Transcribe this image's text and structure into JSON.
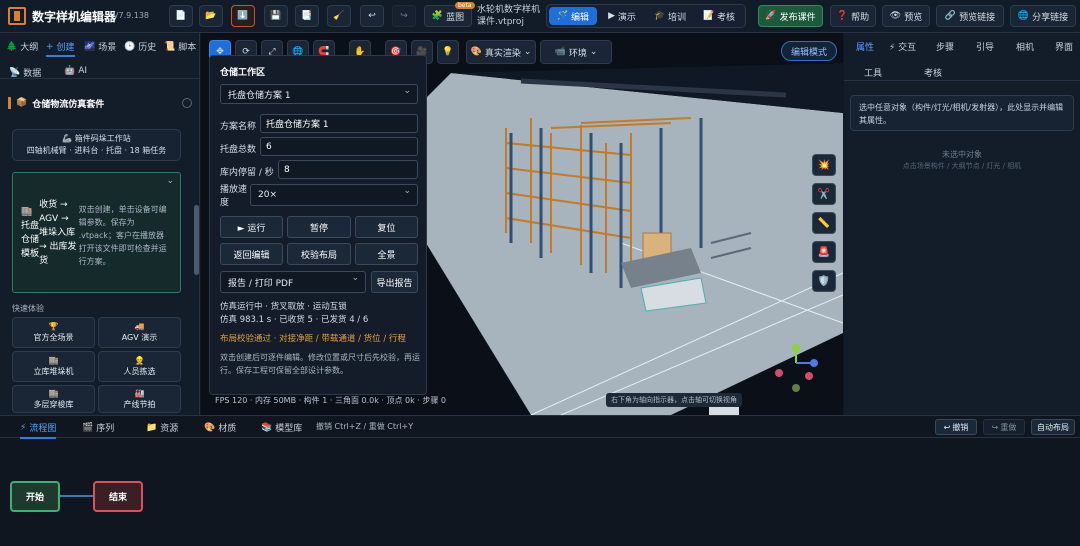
{
  "app": {
    "title": "数字样机编辑器",
    "version": "V7.9.138",
    "badge": "beta",
    "project": "水轮机数字样机课件.vtproj"
  },
  "toolbar": {
    "new_icon": "📄",
    "open_icon": "📂",
    "import_icon": "⬇️",
    "save_icon": "💾",
    "saveas_icon": "📑",
    "clear_icon": "🧹",
    "undo_icon": "↩",
    "redo_icon": "↪",
    "blueprint_icon": "🧩",
    "blueprint_label": "蓝图",
    "modes": [
      {
        "icon": "🪄",
        "label": "编辑"
      },
      {
        "icon": "▶",
        "label": "演示"
      },
      {
        "icon": "🎓",
        "label": "培训"
      },
      {
        "icon": "📝",
        "label": "考核"
      }
    ],
    "publish_icon": "🚀",
    "publish_label": "发布课件",
    "help_icon": "❓",
    "help_label": "帮助",
    "preview_icon": "👁",
    "preview_label": "预览",
    "preview_link_icon": "🔗",
    "preview_link_label": "预览链接",
    "share_icon": "🌐",
    "share_label": "分享链接"
  },
  "left": {
    "tabs": [
      {
        "icon": "🌲",
        "label": "大纲"
      },
      {
        "icon": "+",
        "label": "创建"
      },
      {
        "icon": "🌌",
        "label": "场景"
      },
      {
        "icon": "🕒",
        "label": "历史"
      },
      {
        "icon": "📜",
        "label": "脚本"
      },
      {
        "icon": "📡",
        "label": "数据"
      },
      {
        "icon": "🤖",
        "label": "AI"
      }
    ],
    "kit_icon": "📦",
    "kit_title": "仓储物流仿真套件",
    "card1_icon": "🦾",
    "card1_title": "箱件码垛工作站",
    "card1_desc": "四轴机械臂 · 进料台 · 托盘 · 18 箱任务",
    "card2_icon": "🏬",
    "card2_title": "托盘仓储模板",
    "card2_flow": "收货 → AGV → 堆垛入库 → 出库发货",
    "card2_desc": "双击创建，单击设备可编辑参数。保存为 .vtpack；客户在播放器打开该文件即可检查并运行方案。",
    "quick_title": "快速体验",
    "quick": [
      {
        "icon": "🏆",
        "label": "官方全场景"
      },
      {
        "icon": "🚚",
        "label": "AGV 演示"
      },
      {
        "icon": "🏬",
        "label": "立库堆垛机"
      },
      {
        "icon": "👷",
        "label": "人员拣选"
      },
      {
        "icon": "🏬",
        "label": "多层穿梭库"
      },
      {
        "icon": "🏭",
        "label": "产线节拍"
      }
    ]
  },
  "viewport": {
    "render_icon": "🎨",
    "render_label": "真实渲染",
    "env_icon": "📹",
    "env_label": "环境",
    "edit_mode": "编辑模式",
    "fps": "FPS 120 · 内存 50MB · 构件 1 · 三角面 0.0k · 顶点 0k · 步骤 0",
    "hint": "右下角为轴向指示器，点击轴可切换视角",
    "tool_icons": [
      "💥",
      "✂️",
      "📏",
      "🚨",
      "🛡️"
    ]
  },
  "panel": {
    "title": "仓储工作区",
    "scheme_select": "托盘仓储方案 1",
    "name_label": "方案名称",
    "name_value": "托盘仓储方案 1",
    "pallet_label": "托盘总数",
    "pallet_value": "6",
    "dwell_label": "库内停留 / 秒",
    "dwell_value": "8",
    "speed_label": "播放速度",
    "speed_value": "20×",
    "btn_run": "► 运行",
    "btn_pause": "暂停",
    "btn_reset": "复位",
    "btn_back": "返回编辑",
    "btn_check": "校验布局",
    "btn_full": "全景",
    "report_select": "报告 / 打印 PDF",
    "btn_export": "导出报告",
    "status1": "仿真运行中 · 货叉取放 · 运动互锁",
    "status2": "仿真 983.1 s · 已收货 5 · 已发货 4 / 6",
    "check": "布局校验通过 · 对接净距 / 带载通道 / 货位 / 行程",
    "note": "双击创建后可逐件编辑。修改位置或尺寸后先校验，再运行。保存工程可保留全部设计参数。"
  },
  "right": {
    "tabs": [
      "属性",
      "⚡ 交互",
      "步骤",
      "引导",
      "相机",
      "界面"
    ],
    "subtabs": [
      "工具",
      "考核"
    ],
    "info": "选中任意对象（构件/灯光/相机/发射器），此处显示并编辑其属性。",
    "empty_title": "未选中对象",
    "empty_hint": "点击场景构件 / 大纲节点 / 灯光 / 相机"
  },
  "bottom": {
    "tabs": [
      {
        "icon": "⚡",
        "label": "流程图"
      },
      {
        "icon": "🎬",
        "label": "序列"
      },
      {
        "icon": "📁",
        "label": "资源"
      },
      {
        "icon": "🎨",
        "label": "材质"
      },
      {
        "icon": "📚",
        "label": "模型库"
      }
    ],
    "shortcut": "撤销 Ctrl+Z / 重做 Ctrl+Y",
    "undo": "撤销",
    "redo": "重做",
    "autolayout": "自动布局",
    "node_start": "开始",
    "node_end": "结束"
  },
  "colors": {
    "accent": "#1e6fd9",
    "start_node": "#3bb273",
    "end_node": "#e0505a"
  }
}
